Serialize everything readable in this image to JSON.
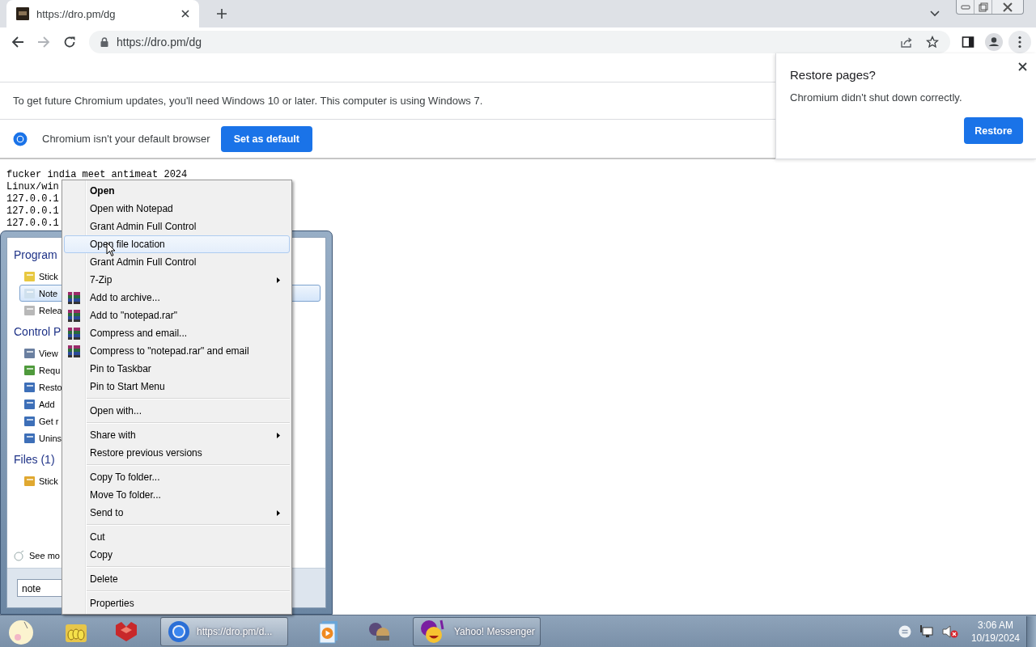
{
  "browser": {
    "tab": {
      "title": "https://dro.pm/dg"
    },
    "address": "https://dro.pm/dg",
    "infobars": [
      {
        "kind": "text",
        "text": "To get future Chromium updates, you'll need Windows 10 or later. This computer is using Windows 7."
      },
      {
        "kind": "default",
        "text": "Chromium isn't your default browser",
        "button": "Set as default"
      }
    ],
    "restore_popup": {
      "title": "Restore pages?",
      "message": "Chromium didn't shut down correctly.",
      "button": "Restore"
    }
  },
  "page_lines": [
    "fucker india meet antimeat 2024",
    "Linux/win",
    "127.0.0.1",
    "127.0.0.1",
    "127.0.0.1"
  ],
  "start_menu": {
    "sections": [
      {
        "header": "Program",
        "items": [
          {
            "label": "Stick",
            "selected": false
          },
          {
            "label": "Note",
            "selected": true
          },
          {
            "label": "Relea",
            "selected": false
          }
        ]
      },
      {
        "header": "Control P",
        "items": [
          {
            "label": "View",
            "selected": false
          },
          {
            "label": "Requ",
            "selected": false
          },
          {
            "label": "Resto",
            "selected": false
          },
          {
            "label": "Add",
            "selected": false
          },
          {
            "label": "Get r",
            "selected": false
          },
          {
            "label": "Unins",
            "selected": false
          }
        ]
      },
      {
        "header": "Files (1)",
        "items": [
          {
            "label": "Stick",
            "selected": false
          }
        ]
      }
    ],
    "see_more": "See mo",
    "search": {
      "value": "note"
    }
  },
  "context_menu": {
    "groups": [
      {
        "items": [
          {
            "label": "Open",
            "kind": "plain",
            "default": true,
            "selected": false,
            "submenu": false
          },
          {
            "label": "Open with Notepad",
            "kind": "plain",
            "default": false,
            "selected": false,
            "submenu": false
          },
          {
            "label": "Grant Admin Full Control",
            "kind": "plain",
            "default": false,
            "selected": false,
            "submenu": false
          },
          {
            "label": "Open file location",
            "kind": "plain",
            "default": false,
            "selected": true,
            "submenu": false
          },
          {
            "label": "Grant Admin Full Control",
            "kind": "plain",
            "default": false,
            "selected": false,
            "submenu": false
          },
          {
            "label": "7-Zip",
            "kind": "plain",
            "default": false,
            "selected": false,
            "submenu": true
          },
          {
            "label": "Add to archive...",
            "kind": "archive",
            "default": false,
            "selected": false,
            "submenu": false
          },
          {
            "label": "Add to \"notepad.rar\"",
            "kind": "archive",
            "default": false,
            "selected": false,
            "submenu": false
          },
          {
            "label": "Compress and email...",
            "kind": "archive",
            "default": false,
            "selected": false,
            "submenu": false
          },
          {
            "label": "Compress to \"notepad.rar\" and email",
            "kind": "archive",
            "default": false,
            "selected": false,
            "submenu": false
          },
          {
            "label": "Pin to Taskbar",
            "kind": "plain",
            "default": false,
            "selected": false,
            "submenu": false
          },
          {
            "label": "Pin to Start Menu",
            "kind": "plain",
            "default": false,
            "selected": false,
            "submenu": false
          }
        ]
      },
      {
        "items": [
          {
            "label": "Open with...",
            "kind": "plain",
            "default": false,
            "selected": false,
            "submenu": false
          }
        ]
      },
      {
        "items": [
          {
            "label": "Share with",
            "kind": "plain",
            "default": false,
            "selected": false,
            "submenu": true
          },
          {
            "label": "Restore previous versions",
            "kind": "plain",
            "default": false,
            "selected": false,
            "submenu": false
          }
        ]
      },
      {
        "items": [
          {
            "label": "Copy To folder...",
            "kind": "plain",
            "default": false,
            "selected": false,
            "submenu": false
          },
          {
            "label": "Move To folder...",
            "kind": "plain",
            "default": false,
            "selected": false,
            "submenu": false
          },
          {
            "label": "Send to",
            "kind": "plain",
            "default": false,
            "selected": false,
            "submenu": true
          }
        ]
      },
      {
        "items": [
          {
            "label": "Cut",
            "kind": "plain",
            "default": false,
            "selected": false,
            "submenu": false
          },
          {
            "label": "Copy",
            "kind": "plain",
            "default": false,
            "selected": false,
            "submenu": false
          }
        ]
      },
      {
        "items": [
          {
            "label": "Delete",
            "kind": "plain",
            "default": false,
            "selected": false,
            "submenu": false
          }
        ]
      },
      {
        "items": [
          {
            "label": "Properties",
            "kind": "plain",
            "default": false,
            "selected": false,
            "submenu": false
          }
        ]
      }
    ]
  },
  "taskbar": {
    "tasks": [
      {
        "label": "https://dro.pm/d...",
        "selected": true
      },
      {
        "label": "Yahoo! Messenger",
        "selected": false
      }
    ],
    "clock": {
      "time": "3:06 AM",
      "date": "10/19/2024"
    }
  }
}
